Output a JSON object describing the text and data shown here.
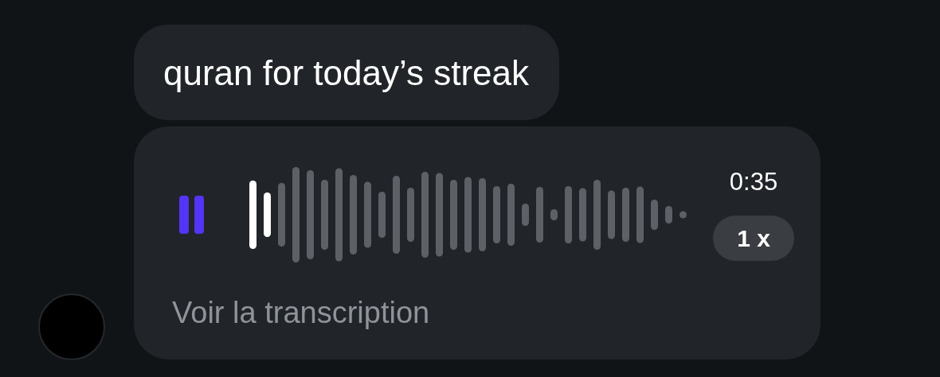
{
  "messages": [
    {
      "kind": "text",
      "text": "quran for today’s streak"
    },
    {
      "kind": "voice",
      "playing": true,
      "level": 0.065,
      "duration": "0:35",
      "speed": "1 x",
      "transcript_link": "Voir la transcription"
    }
  ]
}
